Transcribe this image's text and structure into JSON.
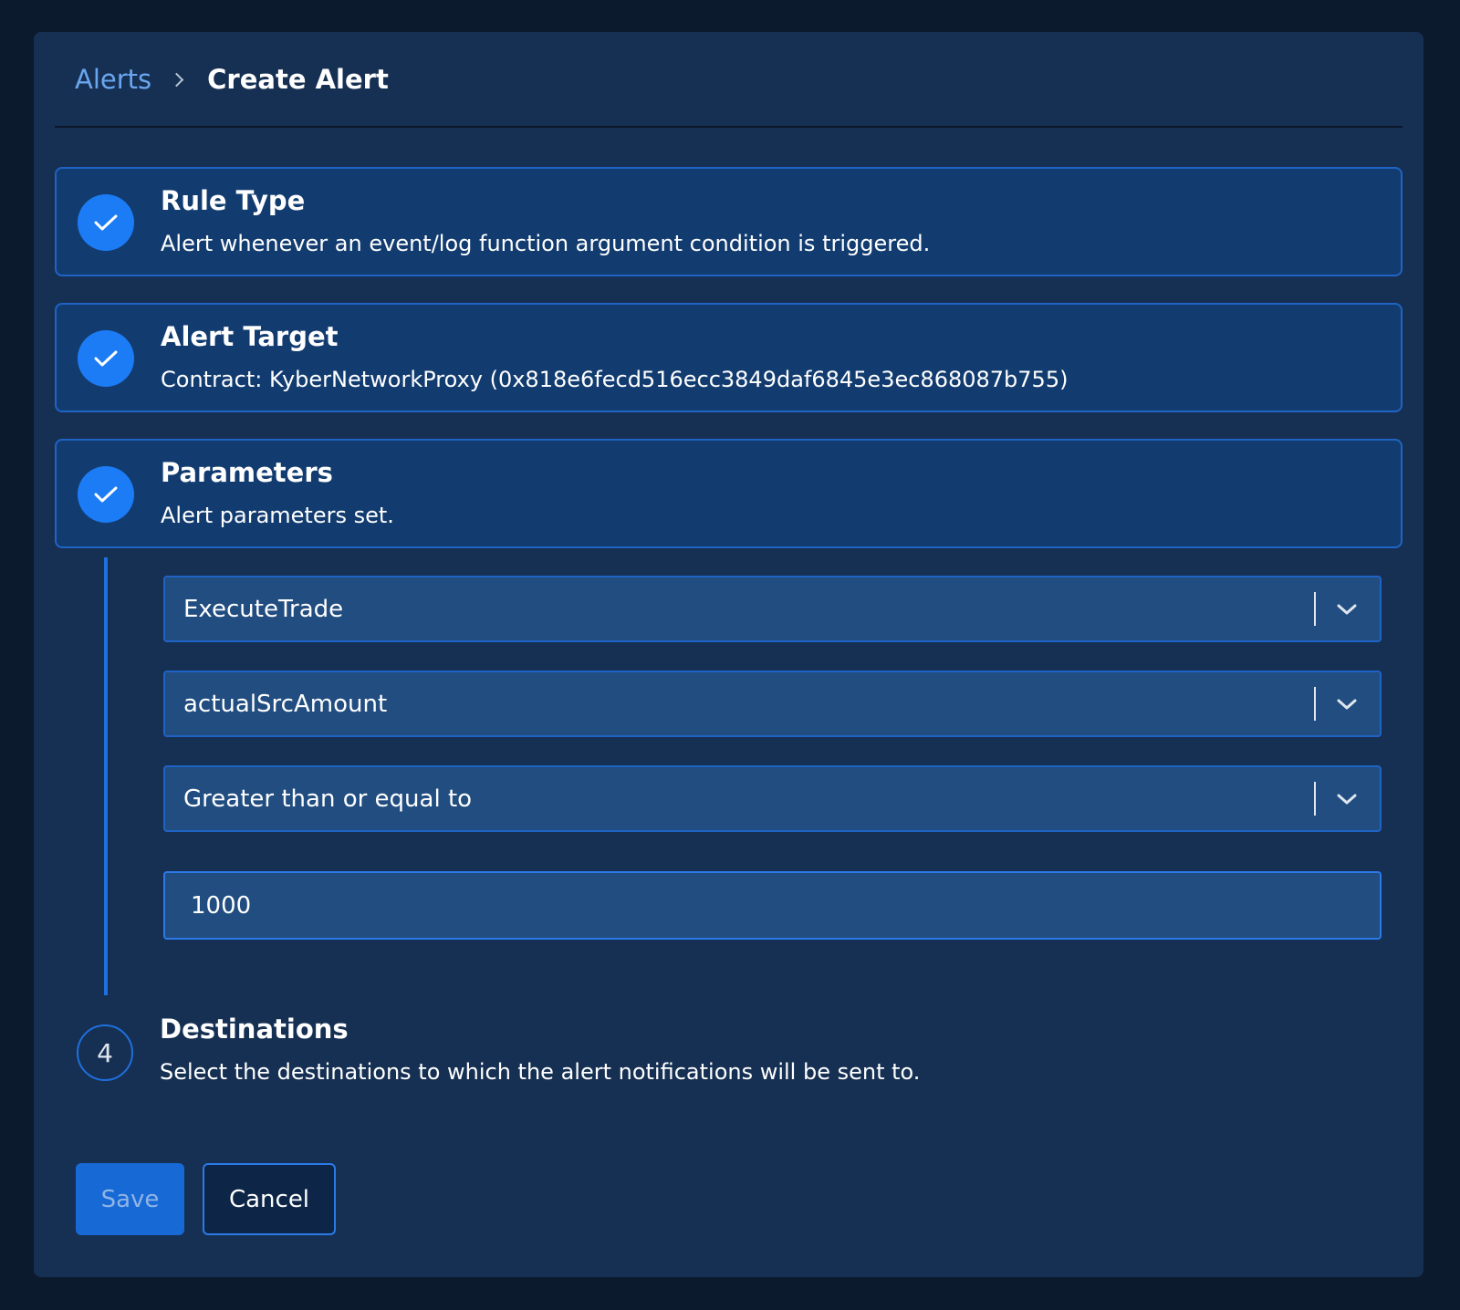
{
  "breadcrumb": {
    "parent": "Alerts",
    "current": "Create Alert"
  },
  "steps": [
    {
      "title": "Rule Type",
      "description": "Alert whenever an event/log function argument condition is triggered.",
      "status": "complete"
    },
    {
      "title": "Alert Target",
      "description": "Contract: KyberNetworkProxy (0x818e6fecd516ecc3849daf6845e3ec868087b755)",
      "status": "complete"
    },
    {
      "title": "Parameters",
      "description": "Alert parameters set.",
      "status": "complete"
    },
    {
      "number": "4",
      "title": "Destinations",
      "description": "Select the destinations to which the alert notifications will be sent to.",
      "status": "pending"
    }
  ],
  "parameters": {
    "event_select": "ExecuteTrade",
    "argument_select": "actualSrcAmount",
    "condition_select": "Greater than or equal to",
    "value_input": "1000"
  },
  "actions": {
    "save_label": "Save",
    "cancel_label": "Cancel"
  },
  "icons": {
    "step_complete": "checkmark-icon",
    "select_arrow": "chevron-down-icon",
    "breadcrumb_separator": "chevron-right-icon"
  },
  "colors": {
    "page_background": "#0c1a2d",
    "panel_background": "#163053",
    "card_background": "#123c70",
    "accent": "#1c7cf6",
    "link": "#6aa6ef"
  }
}
